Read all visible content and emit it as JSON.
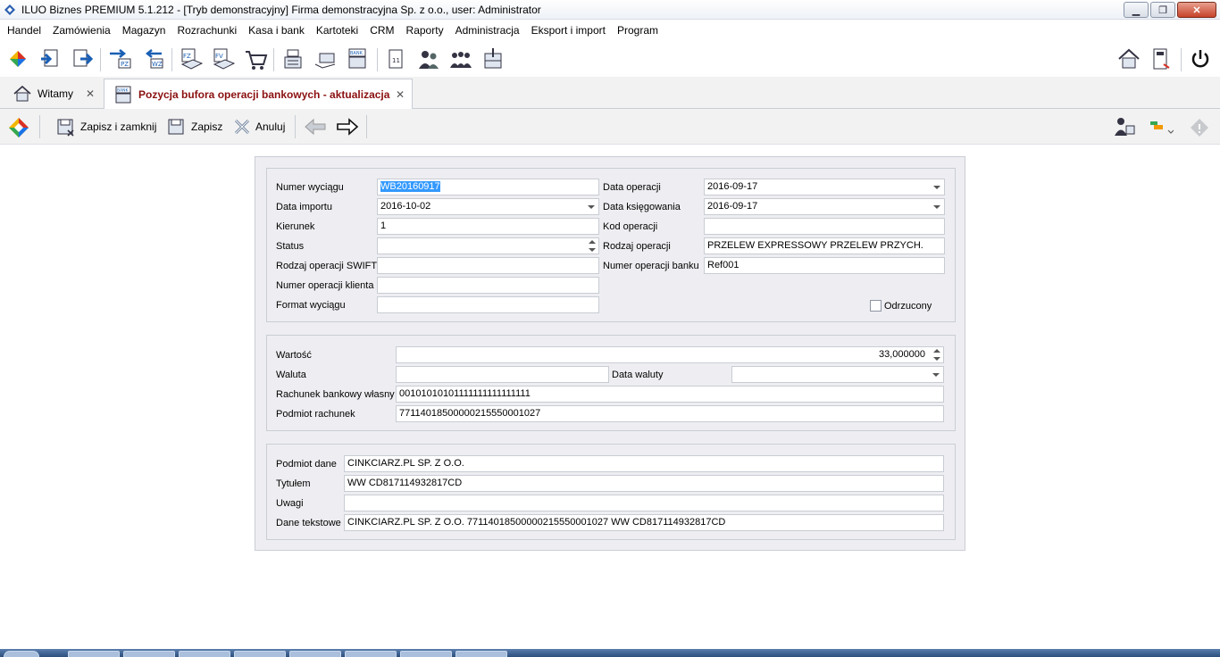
{
  "window": {
    "title": "ILUO Biznes PREMIUM 5.1.212 - [Tryb demonstracyjny] Firma demonstracyjna Sp. z o.o., user: Administrator",
    "minimize_symbol": "▁",
    "maximize_symbol": "❐",
    "close_symbol": "✕"
  },
  "menu": [
    "Handel",
    "Zamówienia",
    "Magazyn",
    "Rozrachunki",
    "Kasa i bank",
    "Kartoteki",
    "CRM",
    "Raporty",
    "Administracja",
    "Eksport i import",
    "Program"
  ],
  "tabs": [
    {
      "label": "Witamy",
      "icon": "home-icon",
      "close": "✕"
    },
    {
      "label": "Pozycja bufora operacji bankowych - aktualizacja",
      "icon": "bank-icon",
      "close": "✕"
    }
  ],
  "actions": {
    "save_close": "Zapisz i zamknij",
    "save": "Zapisz",
    "cancel": "Anuluj"
  },
  "section1": {
    "numer_wyciagu": {
      "label": "Numer wyciągu",
      "value": "WB20160917"
    },
    "data_importu": {
      "label": "Data importu",
      "value": "2016-10-02"
    },
    "kierunek": {
      "label": "Kierunek",
      "value": "1"
    },
    "status": {
      "label": "Status",
      "value": ""
    },
    "rodzaj_swift": {
      "label": "Rodzaj operacji SWIFT",
      "value": ""
    },
    "numer_klienta": {
      "label": "Numer operacji klienta",
      "value": ""
    },
    "format_wyciagu": {
      "label": "Format wyciągu",
      "value": ""
    },
    "data_operacji": {
      "label": "Data operacji",
      "value": "2016-09-17"
    },
    "data_ksiegowania": {
      "label": "Data księgowania",
      "value": "2016-09-17"
    },
    "kod_operacji": {
      "label": "Kod operacji",
      "value": ""
    },
    "rodzaj_operacji": {
      "label": "Rodzaj operacji",
      "value": "PRZELEW EXPRESSOWY PRZELEW PRZYCH."
    },
    "numer_banku": {
      "label": "Numer operacji banku",
      "value": "Ref001"
    },
    "odrzucony": {
      "label": "Odrzucony",
      "checked": false
    }
  },
  "section2": {
    "wartosc": {
      "label": "Wartość",
      "value": "33,000000"
    },
    "waluta": {
      "label": "Waluta",
      "value": ""
    },
    "data_waluty": {
      "label": "Data waluty",
      "value": ""
    },
    "rachunek_wlasny": {
      "label": "Rachunek bankowy własny",
      "value": "00101010101111111111111111"
    },
    "podmiot_rachunek": {
      "label": "Podmiot rachunek",
      "value": "77114018500000215550001027"
    }
  },
  "section3": {
    "podmiot_dane": {
      "label": "Podmiot dane",
      "value": "CINKCIARZ.PL SP. Z O.O."
    },
    "tytulem": {
      "label": "Tytułem",
      "value": "WW CD817114932817CD"
    },
    "uwagi": {
      "label": "Uwagi",
      "value": ""
    },
    "dane_tekstowe": {
      "label": "Dane tekstowe",
      "value": "CINKCIARZ.PL SP. Z O.O. 77114018500000215550001027 WW CD817114932817CD"
    }
  }
}
